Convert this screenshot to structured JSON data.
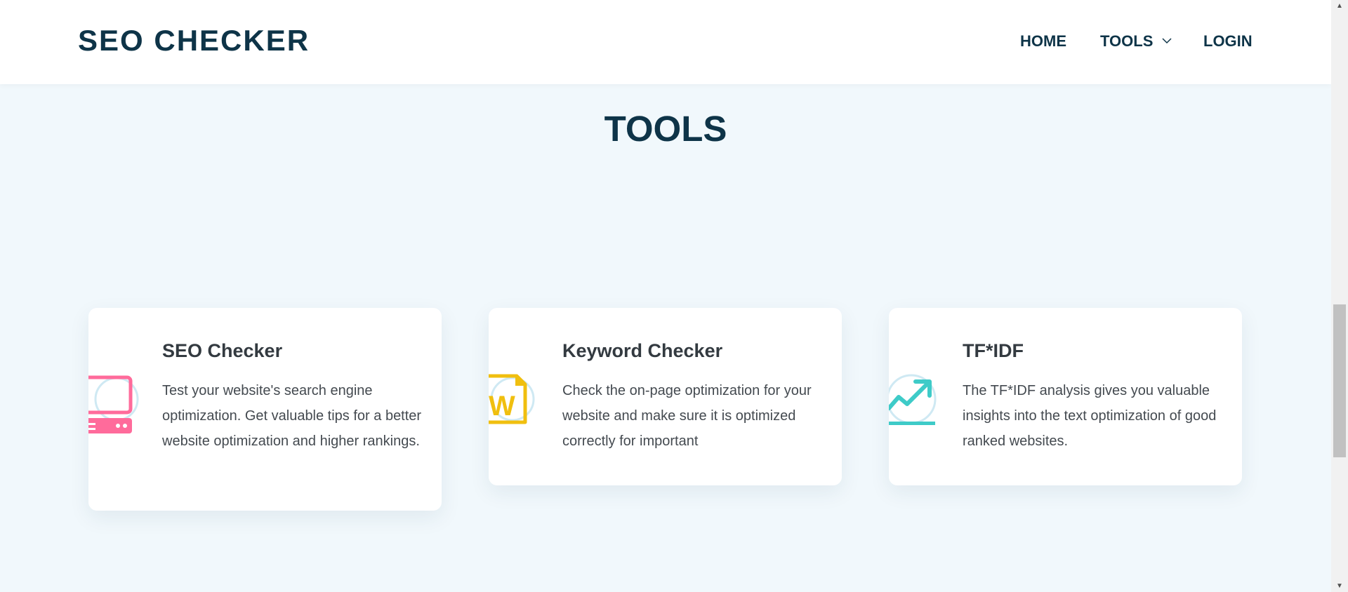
{
  "header": {
    "logo": "SEO CHECKER",
    "nav": {
      "home": "HOME",
      "tools": "TOOLS",
      "login": "LOGIN"
    }
  },
  "main": {
    "title": "TOOLS",
    "cards": [
      {
        "title": "SEO Checker",
        "text": "Test your website's search engine optimization. Get valuable tips for a better website optimization and higher rankings.",
        "icon": "computer-icon",
        "icon_color": "#ff6b9b"
      },
      {
        "title": "Keyword Checker",
        "text": "Check the on-page optimization for your website and make sure it is optimized correctly for important",
        "icon": "word-document-icon",
        "icon_color": "#f0bf0f"
      },
      {
        "title": "TF*IDF",
        "text": "The TF*IDF analysis gives you valuable insights into the text optimization of good ranked websites.",
        "icon": "trend-chart-icon",
        "icon_color": "#3ecbc8"
      }
    ]
  },
  "colors": {
    "primary": "#0e3448",
    "background": "#f1f8fc",
    "card": "#ffffff"
  }
}
